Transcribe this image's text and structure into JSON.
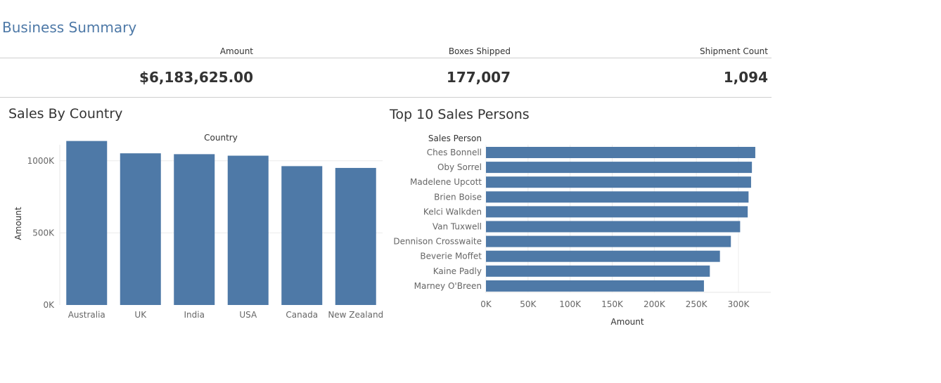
{
  "page": {
    "title": "Business Summary"
  },
  "kpis": [
    {
      "label": "Amount",
      "value": "$6,183,625.00"
    },
    {
      "label": "Boxes Shipped",
      "value": "177,007"
    },
    {
      "label": "Shipment Count",
      "value": "1,094"
    }
  ],
  "colors": {
    "bar": "#4e79a7",
    "title": "#4e79a7"
  },
  "chart_data": [
    {
      "type": "bar",
      "title": "Sales By Country",
      "xlabel": "Country",
      "ylabel": "Amount",
      "categories": [
        "Australia",
        "UK",
        "India",
        "USA",
        "Canada",
        "New Zealand"
      ],
      "values": [
        1137250,
        1051792,
        1045800,
        1035349,
        962899,
        950418
      ],
      "ylim": [
        0,
        1150000
      ],
      "yticks": [
        0,
        500000,
        1000000
      ],
      "ytick_labels": [
        "0K",
        "500K",
        "1000K"
      ],
      "grid": true
    },
    {
      "type": "bar",
      "orientation": "horizontal",
      "title": "Top 10 Sales Persons",
      "ycolumn_header": "Sales Person",
      "xlabel": "Amount",
      "categories": [
        "Ches Bonnell",
        "Oby Sorrel",
        "Madelene Upcott",
        "Brien Boise",
        "Kelci Walkden",
        "Van Tuxwell",
        "Dennison Crosswaite",
        "Beverie Moffet",
        "Kaine Padly",
        "Marney O'Breen"
      ],
      "values": [
        320000,
        316000,
        315000,
        312000,
        311000,
        302000,
        291000,
        278000,
        266000,
        259000
      ],
      "xlim": [
        0,
        330000
      ],
      "xticks": [
        0,
        50000,
        100000,
        150000,
        200000,
        250000,
        300000
      ],
      "xtick_labels": [
        "0K",
        "50K",
        "100K",
        "150K",
        "200K",
        "250K",
        "300K"
      ],
      "grid": true
    }
  ]
}
